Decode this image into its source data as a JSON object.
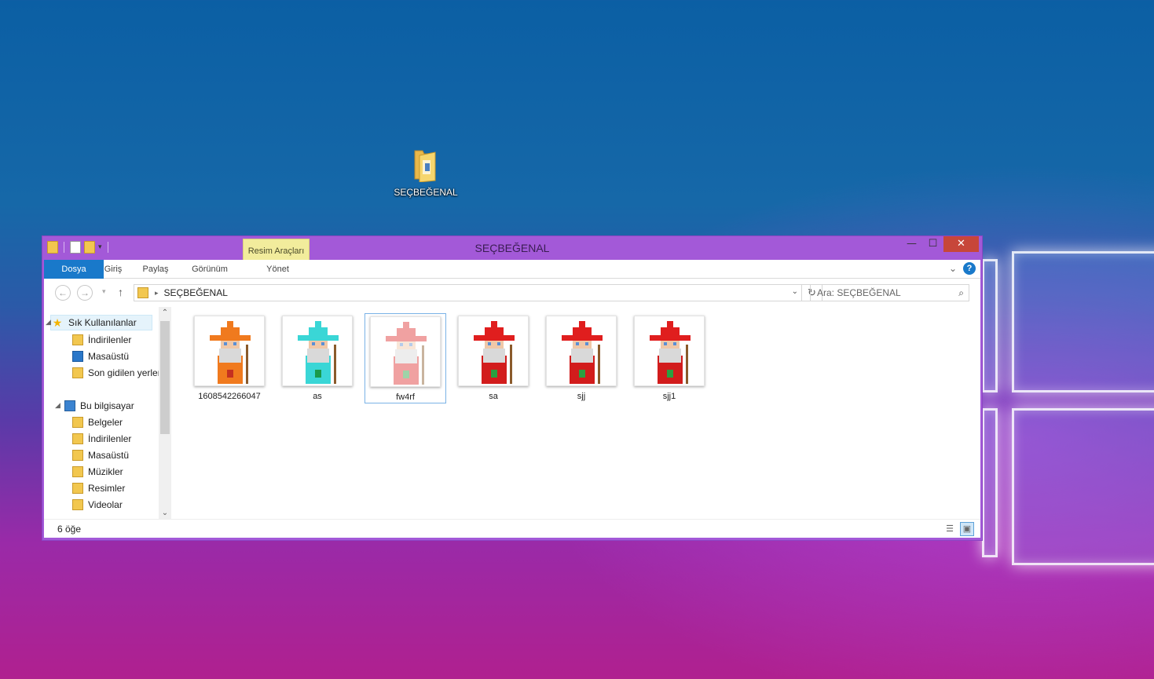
{
  "desktop": {
    "folder_icon": "folder-icon",
    "folder_label": "SEÇBEĞENAL"
  },
  "window": {
    "title": "SEÇBEĞENAL",
    "theme_color": "#a359d8",
    "context_tab": "Resim Araçları",
    "controls": {
      "minimize": "—",
      "maximize": "☐",
      "close": "✕"
    }
  },
  "ribbon": {
    "tabs": [
      "Dosya",
      "Giriş",
      "Paylaş",
      "Görünüm",
      "Yönet"
    ],
    "active_tab_color": "#1979ca",
    "help": "?"
  },
  "navigation": {
    "back": "←",
    "forward": "→",
    "up": "↑",
    "breadcrumb": "SEÇBEĞENAL",
    "search_placeholder": "Ara: SEÇBEĞENAL"
  },
  "sidebar": {
    "favorites": {
      "label": "Sık Kullanılanlar",
      "items": [
        "İndirilenler",
        "Masaüstü",
        "Son gidilen yerler"
      ]
    },
    "this_pc": {
      "label": "Bu bilgisayar",
      "items": [
        "Belgeler",
        "İndirilenler",
        "Masaüstü",
        "Müzikler",
        "Resimler",
        "Videolar"
      ]
    }
  },
  "files": [
    {
      "name": "1608542266047",
      "hat": "#f07a1e",
      "robe": "#f07a1e",
      "belt": "#c43020",
      "alpha": 1.0,
      "selected": false
    },
    {
      "name": "as",
      "hat": "#3ad6d6",
      "robe": "#3ad6d6",
      "belt": "#1a9a4a",
      "alpha": 1.0,
      "selected": false
    },
    {
      "name": "fw4rf",
      "hat": "#e03030",
      "robe": "#e03030",
      "belt": "#2aa040",
      "alpha": 0.45,
      "selected": true
    },
    {
      "name": "sa",
      "hat": "#e01e1e",
      "robe": "#d21c1c",
      "belt": "#2aa040",
      "alpha": 1.0,
      "selected": false
    },
    {
      "name": "sjj",
      "hat": "#e01e1e",
      "robe": "#d21c1c",
      "belt": "#2aa040",
      "alpha": 1.0,
      "selected": false
    },
    {
      "name": "sjj1",
      "hat": "#e01e1e",
      "robe": "#d21c1c",
      "belt": "#2aa040",
      "alpha": 1.0,
      "selected": false
    }
  ],
  "status": {
    "item_count": "6 öğe"
  }
}
